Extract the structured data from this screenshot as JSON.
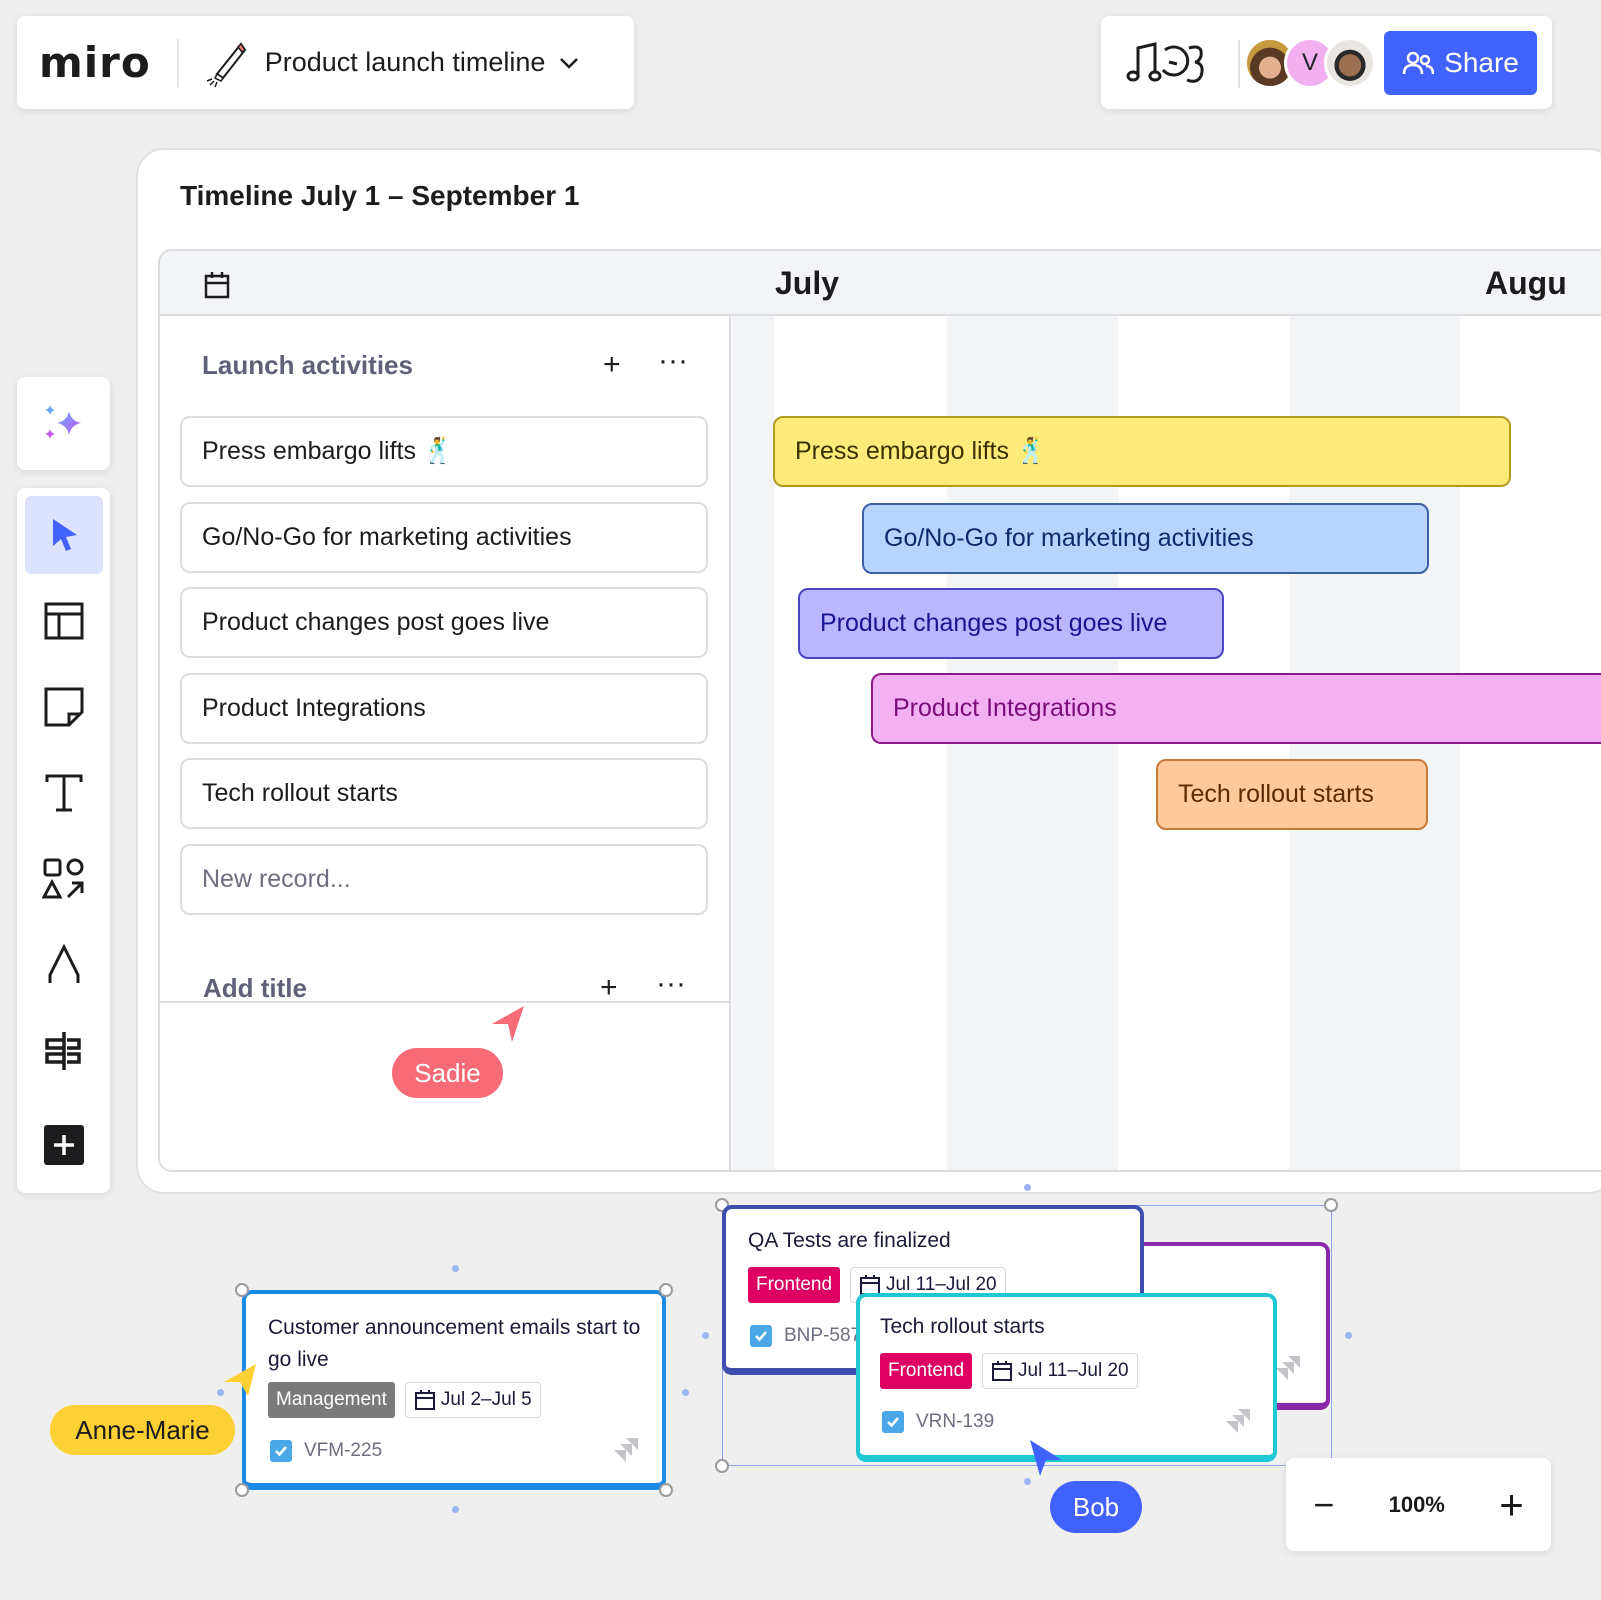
{
  "header": {
    "logo": "miro",
    "board_title": "Product launch timeline",
    "board_icon": "rocket-icon",
    "share_label": "Share",
    "collaborators": [
      {
        "name": "user-1",
        "type": "photo"
      },
      {
        "name": "V",
        "type": "initial",
        "color": "#f3b0f0"
      },
      {
        "name": "user-3",
        "type": "photo"
      }
    ]
  },
  "toolbar": {
    "ai_tool": "sparkles-icon",
    "tools": [
      "select",
      "templates",
      "sticky-note",
      "text",
      "shapes",
      "pen",
      "frame-layout",
      "add"
    ]
  },
  "frame": {
    "title": "Timeline July 1 – September  1",
    "months": [
      "July",
      "Augu"
    ],
    "groups": [
      {
        "title": "Launch activities",
        "records": [
          "Press embargo lifts 🕺",
          "Go/No-Go for marketing activities",
          "Product changes post goes live",
          "Product Integrations",
          "Tech rollout starts"
        ],
        "new_record_placeholder": "New record..."
      },
      {
        "title": "Add title"
      }
    ],
    "bars": [
      {
        "label": "Press embargo lifts 🕺",
        "bg": "#ffeb7a",
        "border": "#b39b22",
        "color": "#3a3000"
      },
      {
        "label": "Go/No-Go for marketing activities",
        "bg": "#b7d4ff",
        "border": "#3c5fa8",
        "color": "#0c2b6b"
      },
      {
        "label": "Product changes post goes live",
        "bg": "#bbb6ff",
        "border": "#4b45c4",
        "color": "#1a1490"
      },
      {
        "label": "Product Integrations",
        "bg": "#f3b0f3",
        "border": "#8a1a8a",
        "color": "#7a0d7a"
      },
      {
        "label": "Tech rollout starts",
        "bg": "#ffc99a",
        "border": "#c77a3a",
        "color": "#5a2a00"
      }
    ]
  },
  "cursors": [
    {
      "name": "Sadie",
      "color": "#f76a78"
    },
    {
      "name": "Anne-Marie",
      "color": "#fdd034"
    },
    {
      "name": "Bob",
      "color": "#4262ff"
    }
  ],
  "cards": [
    {
      "title": "Customer announcement emails start to go live",
      "tag": "Management",
      "tag_color": "#7a7a7a",
      "dates": "Jul 2–Jul 5",
      "key": "VFM-225",
      "border": "#1a8ae6"
    },
    {
      "title": "QA Tests are finalized",
      "tag": "Frontend",
      "tag_color": "#dd0062",
      "dates": "Jul 11–Jul 20",
      "key": "BNP-587",
      "border": "#3d4db0"
    },
    {
      "title": "Tech rollout starts",
      "tag": "Frontend",
      "tag_color": "#dd0062",
      "dates": "Jul 11–Jul 20",
      "key": "VRN-139",
      "border": "#1ec8d4"
    }
  ],
  "zoom": {
    "value": "100%",
    "minus": "−",
    "plus": "+"
  }
}
